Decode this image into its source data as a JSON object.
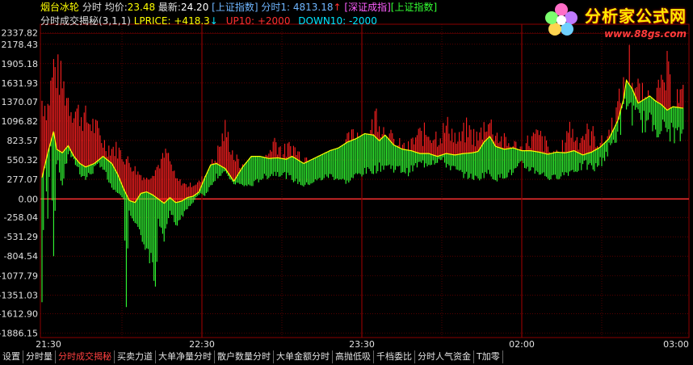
{
  "header": {
    "stock_name": "烟台冰轮",
    "mode": "分时",
    "avg_label": "均价:",
    "avg_value": "23.48",
    "latest_label": "最新:",
    "latest_value": "24.20",
    "index_shanghai": "[上证指数]",
    "fenshi1_label": "分时1:",
    "fenshi1_value": "4813.18",
    "index_shenzhen": "[深证成指]",
    "index_shanghai2": "[上证指数]",
    "indicator": "分时成交揭秘(3,1,1)",
    "lprice_label": "LPRICE:",
    "lprice_value": "+418.3",
    "up10_label": "UP10:",
    "up10_value": "+2000",
    "down10_label": "DOWN10:",
    "down10_value": "-2000"
  },
  "logo": {
    "name": "分析家公式网",
    "url": "www.88gs.com"
  },
  "colors": {
    "up_bar": "#ff2020",
    "down_bar": "#33ff33",
    "line": "#ffff00",
    "grid": "#8b0000",
    "zero_line": "#ff3030",
    "up_arrow": "#ff3030",
    "down_arrow": "#00e5ff"
  },
  "tabs": [
    {
      "label": "设置"
    },
    {
      "label": "分时量"
    },
    {
      "label": "分时成交揭秘",
      "active": true
    },
    {
      "label": "买卖力道"
    },
    {
      "label": "大单净量分时"
    },
    {
      "label": "散户数量分时"
    },
    {
      "label": "大单金额分时"
    },
    {
      "label": "高抛低吸"
    },
    {
      "label": "千档委比"
    },
    {
      "label": "分时人气资金"
    },
    {
      "label": "T加零"
    }
  ],
  "chart_data": {
    "type": "bar",
    "title": "分时成交揭秘(3,1,1)",
    "yticks": [
      2337.82,
      2178.43,
      1905.18,
      1631.93,
      1370.07,
      1096.82,
      823.57,
      550.32,
      277.07,
      0.0,
      -258.04,
      -531.29,
      -804.54,
      -1077.79,
      -1351.03,
      -1612.9,
      -1886.15
    ],
    "xticks": [
      "21:30",
      "22:30",
      "23:30",
      "02:00",
      "03:00"
    ],
    "ylim": [
      -1886.15,
      2337.82
    ],
    "session_end_time": "03:00",
    "grid": true,
    "red_keypoints": [
      [
        0,
        1500
      ],
      [
        4,
        1400
      ],
      [
        8,
        2000
      ],
      [
        12,
        1850
      ],
      [
        20,
        1400
      ],
      [
        28,
        1250
      ],
      [
        36,
        1100
      ],
      [
        44,
        800
      ],
      [
        52,
        750
      ],
      [
        60,
        550
      ],
      [
        66,
        400
      ],
      [
        72,
        300
      ],
      [
        78,
        450
      ],
      [
        86,
        700
      ],
      [
        92,
        300
      ],
      [
        100,
        200
      ],
      [
        108,
        250
      ],
      [
        114,
        400
      ],
      [
        120,
        650
      ],
      [
        126,
        1050
      ],
      [
        132,
        650
      ],
      [
        138,
        450
      ],
      [
        146,
        350
      ],
      [
        152,
        500
      ],
      [
        160,
        900
      ],
      [
        166,
        700
      ],
      [
        172,
        800
      ],
      [
        178,
        650
      ],
      [
        186,
        600
      ],
      [
        194,
        500
      ],
      [
        200,
        650
      ],
      [
        206,
        750
      ],
      [
        212,
        900
      ],
      [
        218,
        1000
      ],
      [
        224,
        850
      ],
      [
        230,
        1300
      ],
      [
        236,
        1000
      ],
      [
        244,
        800
      ],
      [
        252,
        750
      ],
      [
        258,
        950
      ],
      [
        266,
        1000
      ],
      [
        272,
        950
      ],
      [
        280,
        1100
      ],
      [
        286,
        850
      ],
      [
        292,
        1050
      ],
      [
        300,
        900
      ],
      [
        306,
        1200
      ],
      [
        312,
        1000
      ],
      [
        318,
        850
      ],
      [
        324,
        800
      ],
      [
        330,
        750
      ],
      [
        336,
        900
      ],
      [
        342,
        950
      ],
      [
        350,
        700
      ],
      [
        356,
        600
      ],
      [
        362,
        1100
      ],
      [
        368,
        900
      ],
      [
        374,
        1000
      ],
      [
        380,
        950
      ],
      [
        386,
        800
      ],
      [
        392,
        1100
      ],
      [
        398,
        1500
      ],
      [
        402,
        1750
      ],
      [
        404,
        2050
      ],
      [
        408,
        1700
      ],
      [
        414,
        1450
      ],
      [
        420,
        1550
      ],
      [
        426,
        1600
      ],
      [
        430,
        1900
      ],
      [
        434,
        1450
      ],
      [
        438,
        1550
      ],
      [
        440,
        1500
      ]
    ],
    "green_keypoints": [
      [
        0,
        -1500
      ],
      [
        2,
        500
      ],
      [
        4,
        -300
      ],
      [
        6,
        900
      ],
      [
        8,
        -950
      ],
      [
        10,
        600
      ],
      [
        14,
        200
      ],
      [
        18,
        700
      ],
      [
        22,
        600
      ],
      [
        26,
        400
      ],
      [
        30,
        300
      ],
      [
        36,
        450
      ],
      [
        40,
        550
      ],
      [
        44,
        350
      ],
      [
        48,
        150
      ],
      [
        52,
        100
      ],
      [
        56,
        0
      ],
      [
        58,
        -1450
      ],
      [
        60,
        -200
      ],
      [
        64,
        -400
      ],
      [
        68,
        -550
      ],
      [
        72,
        -700
      ],
      [
        76,
        -1000
      ],
      [
        78,
        -1350
      ],
      [
        80,
        -300
      ],
      [
        84,
        -550
      ],
      [
        88,
        -150
      ],
      [
        92,
        -400
      ],
      [
        96,
        -250
      ],
      [
        100,
        -150
      ],
      [
        104,
        -50
      ],
      [
        108,
        100
      ],
      [
        112,
        50
      ],
      [
        116,
        200
      ],
      [
        120,
        350
      ],
      [
        126,
        400
      ],
      [
        132,
        250
      ],
      [
        138,
        200
      ],
      [
        144,
        200
      ],
      [
        150,
        300
      ],
      [
        156,
        350
      ],
      [
        162,
        400
      ],
      [
        168,
        350
      ],
      [
        172,
        300
      ],
      [
        176,
        250
      ],
      [
        180,
        200
      ],
      [
        186,
        250
      ],
      [
        192,
        300
      ],
      [
        198,
        350
      ],
      [
        204,
        300
      ],
      [
        210,
        250
      ],
      [
        216,
        350
      ],
      [
        222,
        400
      ],
      [
        230,
        450
      ],
      [
        236,
        500
      ],
      [
        244,
        450
      ],
      [
        252,
        400
      ],
      [
        258,
        500
      ],
      [
        266,
        550
      ],
      [
        272,
        600
      ],
      [
        280,
        500
      ],
      [
        286,
        400
      ],
      [
        292,
        350
      ],
      [
        300,
        300
      ],
      [
        306,
        400
      ],
      [
        312,
        300
      ],
      [
        318,
        350
      ],
      [
        324,
        400
      ],
      [
        330,
        500
      ],
      [
        336,
        450
      ],
      [
        342,
        400
      ],
      [
        350,
        300
      ],
      [
        356,
        350
      ],
      [
        362,
        400
      ],
      [
        368,
        450
      ],
      [
        374,
        500
      ],
      [
        380,
        450
      ],
      [
        386,
        600
      ],
      [
        392,
        800
      ],
      [
        398,
        1100
      ],
      [
        402,
        1450
      ],
      [
        408,
        1200
      ],
      [
        414,
        1150
      ],
      [
        420,
        1100
      ],
      [
        426,
        1050
      ],
      [
        432,
        1000
      ],
      [
        438,
        950
      ],
      [
        440,
        900
      ]
    ],
    "line_keypoints": [
      [
        0,
        300
      ],
      [
        4,
        650
      ],
      [
        8,
        950
      ],
      [
        10,
        700
      ],
      [
        14,
        650
      ],
      [
        18,
        750
      ],
      [
        22,
        600
      ],
      [
        26,
        500
      ],
      [
        30,
        450
      ],
      [
        36,
        500
      ],
      [
        42,
        600
      ],
      [
        48,
        500
      ],
      [
        52,
        350
      ],
      [
        56,
        150
      ],
      [
        60,
        -20
      ],
      [
        64,
        -50
      ],
      [
        68,
        80
      ],
      [
        72,
        100
      ],
      [
        76,
        60
      ],
      [
        80,
        0
      ],
      [
        84,
        -60
      ],
      [
        88,
        20
      ],
      [
        92,
        -50
      ],
      [
        96,
        -30
      ],
      [
        100,
        20
      ],
      [
        104,
        40
      ],
      [
        108,
        100
      ],
      [
        112,
        300
      ],
      [
        116,
        480
      ],
      [
        120,
        500
      ],
      [
        126,
        430
      ],
      [
        132,
        250
      ],
      [
        138,
        450
      ],
      [
        144,
        600
      ],
      [
        150,
        600
      ],
      [
        156,
        570
      ],
      [
        162,
        580
      ],
      [
        168,
        560
      ],
      [
        172,
        600
      ],
      [
        176,
        550
      ],
      [
        180,
        500
      ],
      [
        186,
        560
      ],
      [
        192,
        620
      ],
      [
        198,
        680
      ],
      [
        204,
        720
      ],
      [
        210,
        800
      ],
      [
        216,
        850
      ],
      [
        222,
        920
      ],
      [
        228,
        900
      ],
      [
        232,
        820
      ],
      [
        236,
        900
      ],
      [
        242,
        760
      ],
      [
        248,
        700
      ],
      [
        254,
        680
      ],
      [
        260,
        640
      ],
      [
        266,
        640
      ],
      [
        272,
        600
      ],
      [
        278,
        640
      ],
      [
        284,
        620
      ],
      [
        290,
        640
      ],
      [
        296,
        650
      ],
      [
        300,
        670
      ],
      [
        304,
        800
      ],
      [
        308,
        880
      ],
      [
        312,
        740
      ],
      [
        318,
        700
      ],
      [
        324,
        720
      ],
      [
        330,
        680
      ],
      [
        336,
        680
      ],
      [
        342,
        660
      ],
      [
        348,
        630
      ],
      [
        354,
        660
      ],
      [
        360,
        650
      ],
      [
        366,
        680
      ],
      [
        372,
        620
      ],
      [
        378,
        660
      ],
      [
        384,
        730
      ],
      [
        390,
        850
      ],
      [
        396,
        1100
      ],
      [
        400,
        1400
      ],
      [
        402,
        1670
      ],
      [
        406,
        1550
      ],
      [
        410,
        1350
      ],
      [
        414,
        1400
      ],
      [
        418,
        1450
      ],
      [
        422,
        1380
      ],
      [
        426,
        1330
      ],
      [
        430,
        1250
      ],
      [
        434,
        1300
      ],
      [
        440,
        1280
      ]
    ]
  }
}
